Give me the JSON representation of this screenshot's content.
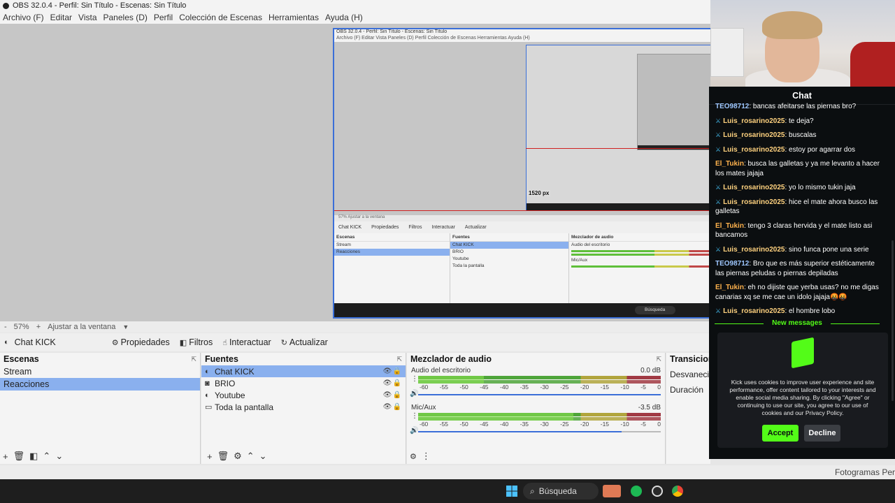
{
  "window": {
    "title": "OBS 32.0.4 - Perfil: Sin Título - Escenas: Sin Título"
  },
  "menu": [
    "Archivo (F)",
    "Editar",
    "Vista",
    "Paneles (D)",
    "Perfil",
    "Colección de Escenas",
    "Herramientas",
    "Ayuda (H)"
  ],
  "nested": {
    "title": "OBS 32.0.4 - Perfil: Sin Título - Escenas: Sin Título",
    "menu": "Archivo (F)   Editar   Vista   Paneles (D)   Perfil   Colección de Escenas   Herramientas   Ayuda (H)",
    "px_label": "1520 px",
    "zoom": "57%     Ajustar a la ventana",
    "source": "Chat KICK",
    "tools": [
      "Propiedades",
      "Filtros",
      "Interactuar",
      "Actualizar"
    ],
    "scenes_title": "Escenas",
    "scenes": [
      "Stream",
      "Reacciones"
    ],
    "sources_title": "Fuentes",
    "sources": [
      "Chat KICK",
      "BRIO",
      "Youtube",
      "Toda la pantalla"
    ],
    "mixer_title": "Mezclador de audio",
    "mixer_tracks": [
      "Audio del escritorio",
      "Mic/Aux"
    ],
    "search": "Búsqueda"
  },
  "zoombar": {
    "minus": "-",
    "zoom": "57%",
    "plus": "+",
    "fit": "Ajustar a la ventana"
  },
  "toolbar": {
    "source": "Chat KICK",
    "properties": "Propiedades",
    "filters": "Filtros",
    "interact": "Interactuar",
    "refresh": "Actualizar"
  },
  "scenes": {
    "title": "Escenas",
    "items": [
      "Stream",
      "Reacciones"
    ],
    "selected": 1
  },
  "sources": {
    "title": "Fuentes",
    "items": [
      {
        "name": "Chat KICK",
        "icon": "globe-icon"
      },
      {
        "name": "BRIO",
        "icon": "camera-icon"
      },
      {
        "name": "Youtube",
        "icon": "globe-icon"
      },
      {
        "name": "Toda la pantalla",
        "icon": "monitor-icon"
      }
    ]
  },
  "mixer": {
    "title": "Mezclador de audio",
    "tracks": [
      {
        "name": "Audio del escritorio",
        "db": "0.0 dB",
        "level": 0.27,
        "volume": 1.0
      },
      {
        "name": "Mic/Aux",
        "db": "-3.5 dB",
        "level": 0.64,
        "volume": 0.84
      }
    ],
    "scale": [
      "-60",
      "-55",
      "-50",
      "-45",
      "-40",
      "-35",
      "-30",
      "-25",
      "-20",
      "-15",
      "-10",
      "-5",
      "0"
    ]
  },
  "transitions": {
    "title": "Transicion",
    "value": "Desvaneci",
    "duration_label": "Duración"
  },
  "status": {
    "right": "Fotogramas Per"
  },
  "taskbar": {
    "search": "Búsqueda"
  },
  "chat": {
    "title": "Chat",
    "messages": [
      {
        "user": "TEO98712",
        "text": ": bancas afeitarse las piernas bro?",
        "color": "#9ec7ff",
        "badge": false
      },
      {
        "user": "Luis_rosarino2025",
        "text": ": te deja?",
        "color": "#ffd27f",
        "badge": true
      },
      {
        "user": "Luis_rosarino2025",
        "text": ": buscalas",
        "color": "#ffd27f",
        "badge": true
      },
      {
        "user": "Luis_rosarino2025",
        "text": ": estoy por agarrar dos",
        "color": "#ffd27f",
        "badge": true
      },
      {
        "user": "El_Tukin",
        "text": ": busca las galletas y ya me levanto a hacer los mates jajaja",
        "color": "#ffb24d",
        "badge": false
      },
      {
        "user": "Luis_rosarino2025",
        "text": ": yo lo mismo tukin jaja",
        "color": "#ffd27f",
        "badge": true
      },
      {
        "user": "Luis_rosarino2025",
        "text": ": hice el mate ahora busco las galletas",
        "color": "#ffd27f",
        "badge": true
      },
      {
        "user": "El_Tukin",
        "text": ": tengo 3 claras hervida y el mate listo asi bancamos",
        "color": "#ffb24d",
        "badge": false
      },
      {
        "user": "Luis_rosarino2025",
        "text": ": sino funca pone una serie",
        "color": "#ffd27f",
        "badge": true
      },
      {
        "user": "TEO98712",
        "text": ": Bro que es más superior estéticamente las piernas peludas o piernas depiladas",
        "color": "#9ec7ff",
        "badge": false
      },
      {
        "user": "El_Tukin",
        "text": ": eh no dijiste que yerba usas? no me digas canarias xq se me cae un idolo jajaja🤬🤬",
        "color": "#ffb24d",
        "badge": false
      },
      {
        "user": "Luis_rosarino2025",
        "text": ": el hombre lobo",
        "color": "#ffd27f",
        "badge": true
      }
    ],
    "new_messages": "New messages",
    "cookie_text": "Kick uses cookies to improve user experience and site performance, offer content tailored to your interests and enable social media sharing. By clicking \"Agree\" or continuing to use our site, you agree to our use of cookies and our Privacy Policy.",
    "accept": "Accept",
    "decline": "Decline"
  },
  "colors": {
    "accent": "#3b6fd8",
    "selection": "#8ab0ee",
    "kick_green": "#53fc18"
  }
}
